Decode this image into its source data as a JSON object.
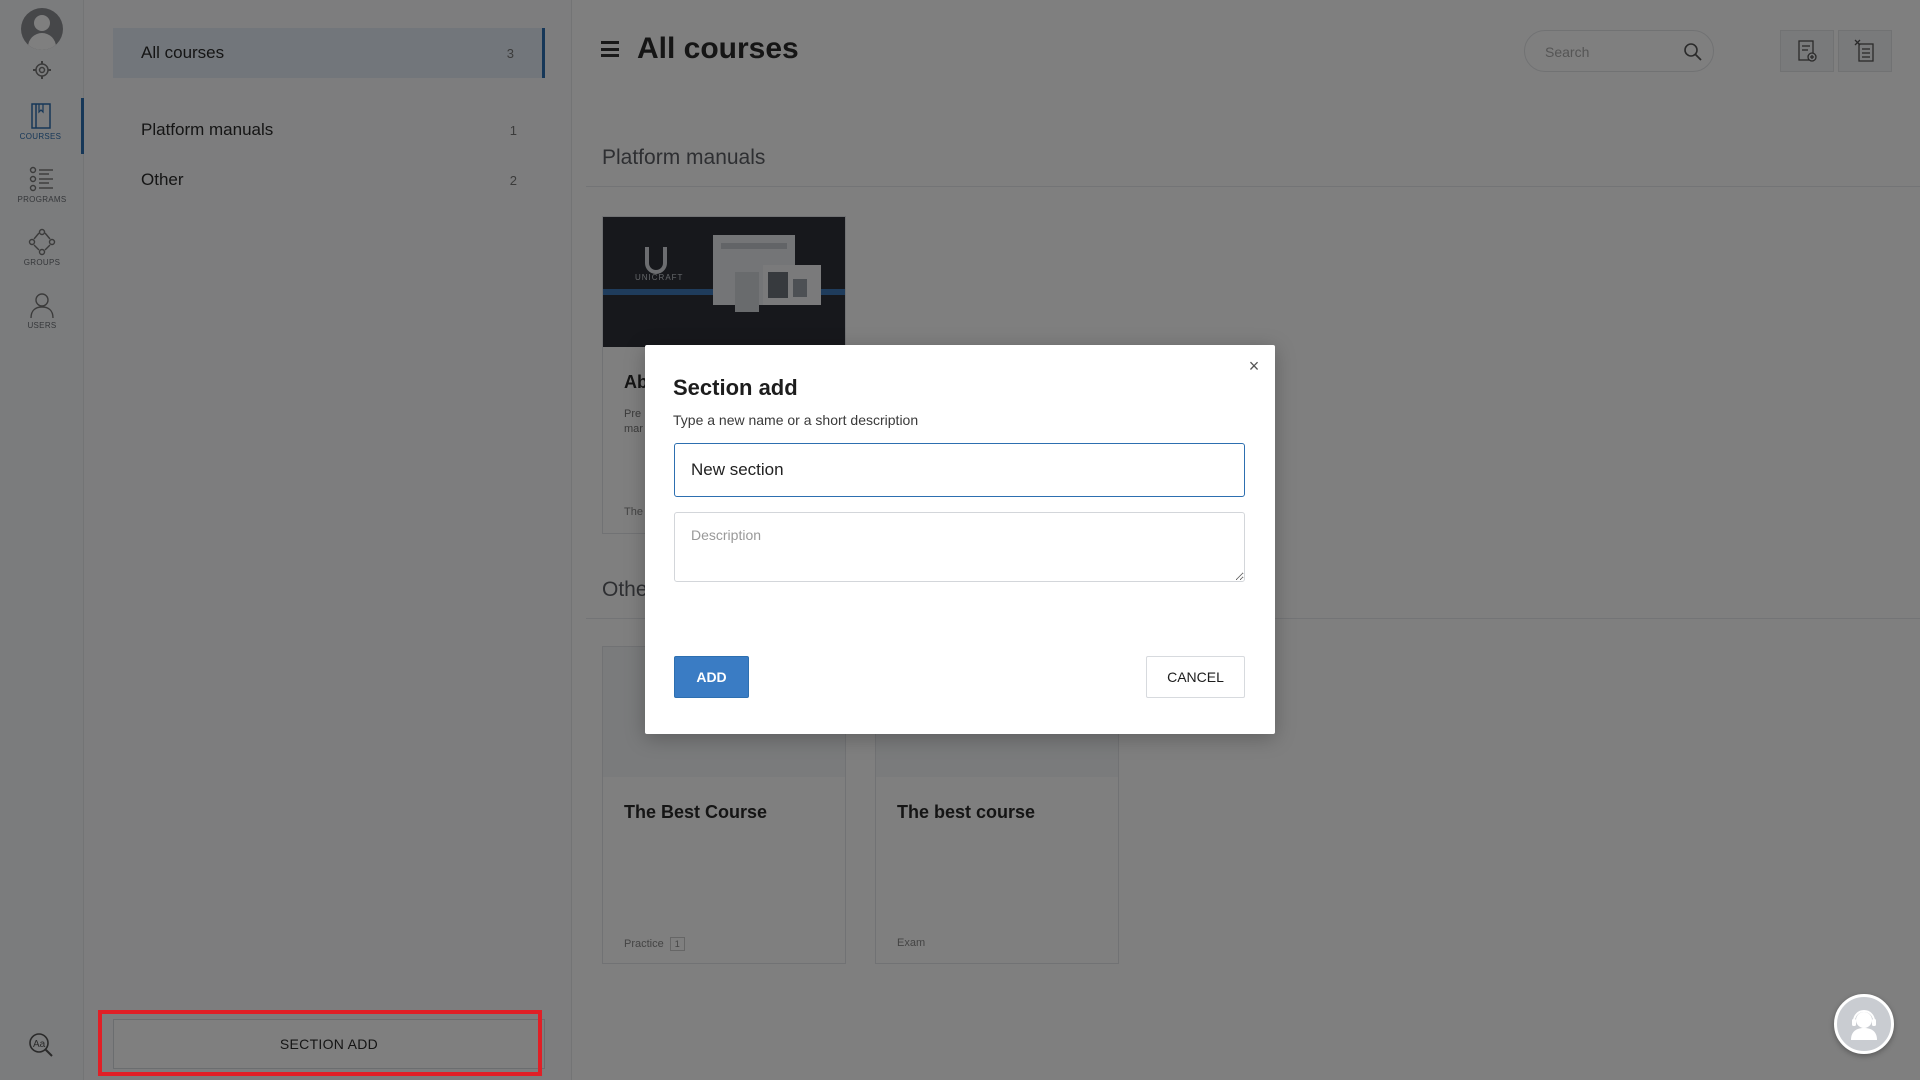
{
  "rail": {
    "items": [
      {
        "label": "COURSES",
        "icon": "book-icon"
      },
      {
        "label": "PROGRAMS",
        "icon": "list-icon"
      },
      {
        "label": "GROUPS",
        "icon": "groups-icon"
      },
      {
        "label": "USERS",
        "icon": "users-icon"
      }
    ]
  },
  "sections": {
    "items": [
      {
        "label": "All courses",
        "count": "3"
      },
      {
        "label": "Platform manuals",
        "count": "1"
      },
      {
        "label": "Other",
        "count": "2"
      }
    ],
    "add_button": "SECTION ADD"
  },
  "header": {
    "title": "All courses",
    "search_placeholder": "Search"
  },
  "groups": [
    {
      "title": "Platform manuals",
      "cards": [
        {
          "title": "Ab",
          "desc": "Pre\nmar",
          "tag": "The",
          "thumb_text": "UNICRAFT"
        }
      ]
    },
    {
      "title": "Othe",
      "cards": [
        {
          "title": "The Best Course",
          "tag": "Practice",
          "tag_count": "1"
        },
        {
          "title": "The best course",
          "tag": "Exam"
        }
      ]
    }
  ],
  "modal": {
    "title": "Section add",
    "subtitle": "Type a new name or a short description",
    "name_value": "New section",
    "description_placeholder": "Description",
    "add_label": "ADD",
    "cancel_label": "CANCEL",
    "close_glyph": "×"
  },
  "colors": {
    "accent": "#2d6fb0",
    "primary_button": "#3a7cc4",
    "highlight": "#e01f26"
  }
}
